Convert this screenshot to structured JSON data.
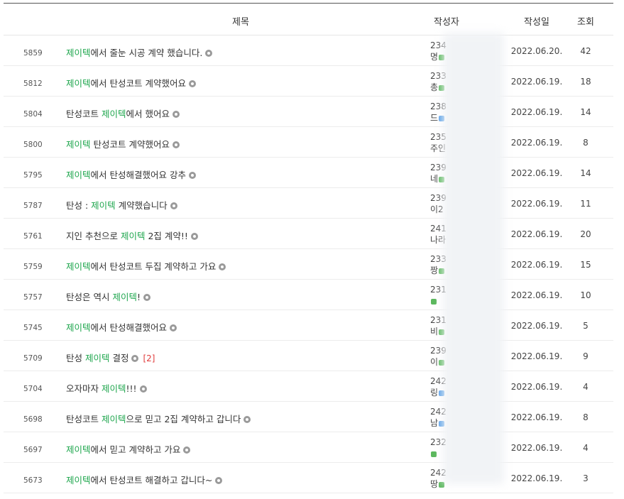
{
  "header": {
    "title": "제목",
    "author": "작성자",
    "date": "작성일",
    "views": "조회"
  },
  "rows": [
    {
      "num": "5859",
      "parts": [
        {
          "t": "제이텍",
          "hl": true
        },
        {
          "t": "에서 줄눈 시공 계약 했습니다.",
          "hl": false
        }
      ],
      "comments": "",
      "author": {
        "l1": "234",
        "l2": "명",
        "badge": "green"
      },
      "date": "2022.06.20.",
      "views": "42"
    },
    {
      "num": "5812",
      "parts": [
        {
          "t": "제이텍",
          "hl": true
        },
        {
          "t": "에서 탄성코트 계약했어요",
          "hl": false
        }
      ],
      "comments": "",
      "author": {
        "l1": "233",
        "l2": "총",
        "badge": "green"
      },
      "date": "2022.06.19.",
      "views": "18"
    },
    {
      "num": "5804",
      "parts": [
        {
          "t": "탄성코트 ",
          "hl": false
        },
        {
          "t": "제이텍",
          "hl": true
        },
        {
          "t": "에서 했어요",
          "hl": false
        }
      ],
      "comments": "",
      "author": {
        "l1": "238",
        "l2": "드",
        "badge": "blue"
      },
      "date": "2022.06.19.",
      "views": "14"
    },
    {
      "num": "5800",
      "parts": [
        {
          "t": "제이텍",
          "hl": true
        },
        {
          "t": " 탄성코트 계약했어요",
          "hl": false
        }
      ],
      "comments": "",
      "author": {
        "l1": "235",
        "l2": "주인",
        "badge": "none"
      },
      "date": "2022.06.19.",
      "views": "8"
    },
    {
      "num": "5795",
      "parts": [
        {
          "t": "제이텍",
          "hl": true
        },
        {
          "t": "에서 탄성해결했어요 강추",
          "hl": false
        }
      ],
      "comments": "",
      "author": {
        "l1": "239",
        "l2": "네",
        "badge": "green"
      },
      "date": "2022.06.19.",
      "views": "14"
    },
    {
      "num": "5787",
      "parts": [
        {
          "t": "탄성 : ",
          "hl": false
        },
        {
          "t": "제이텍",
          "hl": true
        },
        {
          "t": " 계약했습니다",
          "hl": false
        }
      ],
      "comments": "",
      "author": {
        "l1": "239",
        "l2": "이2",
        "badge": "none"
      },
      "date": "2022.06.19.",
      "views": "11"
    },
    {
      "num": "5761",
      "parts": [
        {
          "t": "지인 추천으로 ",
          "hl": false
        },
        {
          "t": "제이텍",
          "hl": true
        },
        {
          "t": " 2집 계약!!",
          "hl": false
        }
      ],
      "comments": "",
      "author": {
        "l1": "241",
        "l2": "나라",
        "badge": "none"
      },
      "date": "2022.06.19.",
      "views": "20"
    },
    {
      "num": "5759",
      "parts": [
        {
          "t": "제이텍",
          "hl": true
        },
        {
          "t": "에서 탄성코트 두집 계약하고 가요",
          "hl": false
        }
      ],
      "comments": "",
      "author": {
        "l1": "233",
        "l2": "짱",
        "badge": "green"
      },
      "date": "2022.06.19.",
      "views": "15"
    },
    {
      "num": "5757",
      "parts": [
        {
          "t": "탄성은 역시 ",
          "hl": false
        },
        {
          "t": "제이텍",
          "hl": true
        },
        {
          "t": "!",
          "hl": false
        }
      ],
      "comments": "",
      "author": {
        "l1": "231",
        "l2": "",
        "badge": "green"
      },
      "date": "2022.06.19.",
      "views": "10"
    },
    {
      "num": "5745",
      "parts": [
        {
          "t": "제이텍",
          "hl": true
        },
        {
          "t": "에서 탄성해결했어요",
          "hl": false
        }
      ],
      "comments": "",
      "author": {
        "l1": "231",
        "l2": "비",
        "badge": "green"
      },
      "date": "2022.06.19.",
      "views": "5"
    },
    {
      "num": "5709",
      "parts": [
        {
          "t": "탄성 ",
          "hl": false
        },
        {
          "t": "제이텍",
          "hl": true
        },
        {
          "t": " 결정",
          "hl": false
        }
      ],
      "comments": "[2]",
      "author": {
        "l1": "239",
        "l2": "이",
        "badge": "green"
      },
      "date": "2022.06.19.",
      "views": "9"
    },
    {
      "num": "5704",
      "parts": [
        {
          "t": "오자마자 ",
          "hl": false
        },
        {
          "t": "제이텍",
          "hl": true
        },
        {
          "t": "!!!",
          "hl": false
        }
      ],
      "comments": "",
      "author": {
        "l1": "242",
        "l2": "링",
        "badge": "blue"
      },
      "date": "2022.06.19.",
      "views": "4"
    },
    {
      "num": "5698",
      "parts": [
        {
          "t": "탄성코트 ",
          "hl": false
        },
        {
          "t": "제이텍",
          "hl": true
        },
        {
          "t": "으로 믿고 2집 계약하고 갑니다",
          "hl": false
        }
      ],
      "comments": "",
      "author": {
        "l1": "242",
        "l2": "남",
        "badge": "blue"
      },
      "date": "2022.06.19.",
      "views": "8"
    },
    {
      "num": "5697",
      "parts": [
        {
          "t": "제이텍",
          "hl": true
        },
        {
          "t": "에서 믿고 계약하고 가요",
          "hl": false
        }
      ],
      "comments": "",
      "author": {
        "l1": "232",
        "l2": "",
        "badge": "green"
      },
      "date": "2022.06.19.",
      "views": "4"
    },
    {
      "num": "5673",
      "parts": [
        {
          "t": "제이텍",
          "hl": true
        },
        {
          "t": "에서 탄성코트 해결하고 갑니다~",
          "hl": false
        }
      ],
      "comments": "",
      "author": {
        "l1": "242",
        "l2": "땅",
        "badge": "green"
      },
      "date": "2022.06.19.",
      "views": "3"
    }
  ]
}
